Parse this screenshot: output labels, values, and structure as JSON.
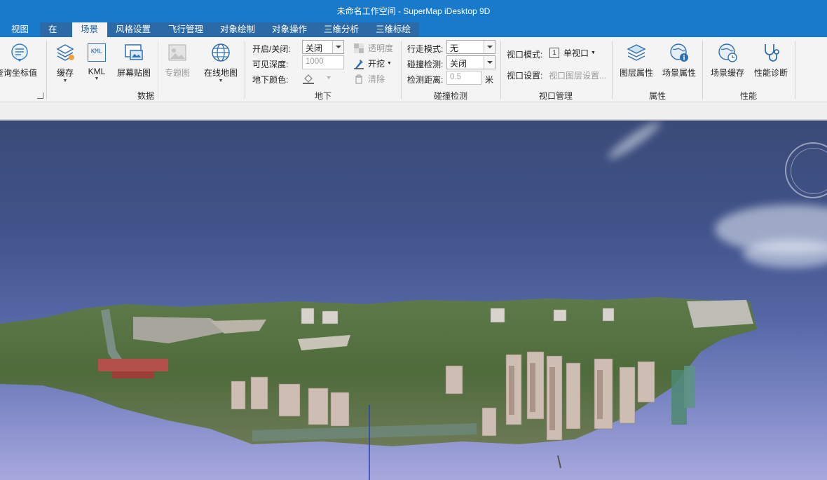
{
  "window": {
    "title": "未命名工作空间 - SuperMap iDesktop 9D"
  },
  "tabs": [
    "视图",
    "在线",
    "场景",
    "风格设置",
    "飞行管理",
    "对象绘制",
    "对象操作",
    "三维分析",
    "三维标绘"
  ],
  "active_tab": "场景",
  "ribbon": {
    "coord_group": {
      "query_coords": "查询坐标值"
    },
    "data_group": {
      "label": "数据",
      "cache": "缓存",
      "kml": "KML",
      "kml_icon_text": "KML",
      "screen_layer": "屏幕贴图",
      "thematic": "专题图",
      "online_map": "在线地图"
    },
    "underground_group": {
      "label": "地下",
      "toggle_label": "开启/关闭:",
      "toggle_value": "关闭",
      "depth_label": "可见深度:",
      "depth_value": "1000",
      "color_label": "地下颜色:",
      "transparency": "透明度",
      "excavate": "开挖",
      "clear": "清除"
    },
    "collision_group": {
      "label": "碰撞检测",
      "walk_label": "行走模式:",
      "walk_value": "无",
      "collision_label": "碰撞检测:",
      "collision_value": "关闭",
      "distance_label": "检测距离:",
      "distance_value": "0.5",
      "distance_unit": "米"
    },
    "viewport_group": {
      "label": "视口管理",
      "mode_label": "视口模式:",
      "mode_value": "单视口",
      "mode_icon_text": "1",
      "settings_label": "视口设置:",
      "settings_value": "视口图层设置..."
    },
    "property_group": {
      "label": "属性",
      "layer_props": "图层属性",
      "scene_props": "场景属性"
    },
    "performance_group": {
      "label": "性能",
      "scene_cache": "场景缓存",
      "perf_diag": "性能诊断"
    }
  },
  "colors": {
    "title_bar": "#1979ca",
    "tab_bg": "#2b6aa6",
    "ribbon_bg": "#f4f4f4",
    "sky_top": "#3a4a78",
    "sky_bottom": "#a8a8de"
  },
  "icons": [
    "coordinate-query-icon",
    "cache-icon",
    "kml-icon",
    "screen-layer-icon",
    "thematic-map-icon",
    "globe-icon",
    "transparency-icon",
    "excavate-icon",
    "trash-icon",
    "fill-color-icon",
    "layer-stack-icon",
    "scene-info-icon",
    "scene-cache-icon",
    "stethoscope-icon",
    "navigation-compass-icon"
  ]
}
